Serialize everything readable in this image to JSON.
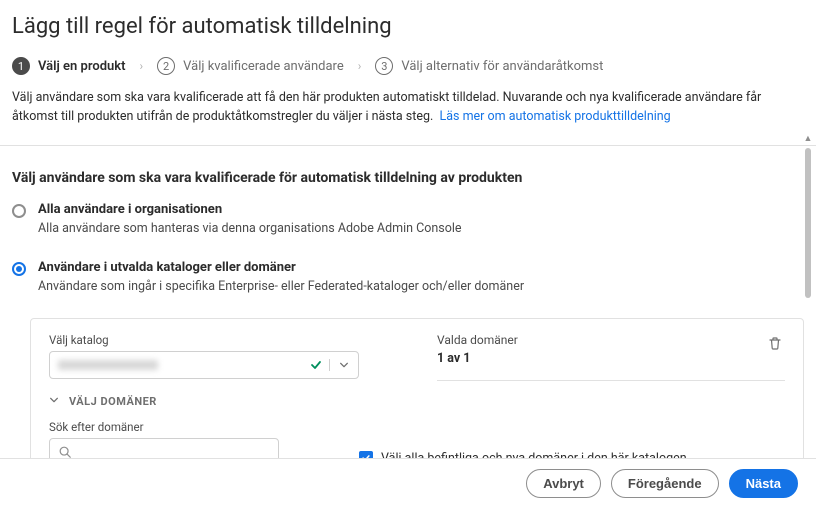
{
  "page": {
    "title": "Lägg till regel för automatisk tilldelning"
  },
  "stepper": {
    "steps": [
      {
        "num": "1",
        "label": "Välj en produkt",
        "active": true
      },
      {
        "num": "2",
        "label": "Välj kvalificerade användare",
        "active": false
      },
      {
        "num": "3",
        "label": "Välj alternativ för användaråtkomst",
        "active": false
      }
    ]
  },
  "intro": {
    "text": "Välj användare som ska vara kvalificerade att få den här produkten automatiskt tilldelad. Nuvarande och nya kvalificerade användare får åtkomst till produkten utifrån de produktåtkomstregler du väljer i nästa steg.",
    "link": "Läs mer om automatisk produkttilldelning"
  },
  "section": {
    "title": "Välj användare som ska vara kvalificerade för automatisk tilldelning av produkten"
  },
  "options": {
    "all": {
      "label": "Alla användare i organisationen",
      "desc": "Alla användare som hanteras via denna organisations Adobe Admin Console"
    },
    "selected": {
      "label": "Användare i utvalda kataloger eller domäner",
      "desc": "Användare som ingår i specifika Enterprise- eller Federated-kataloger och/eller domäner"
    }
  },
  "catalog": {
    "field_label": "Välj katalog",
    "domains_label": "Valda domäner",
    "domains_count": "1 av 1",
    "accordion_label": "VÄLJ DOMÄNER",
    "search_label": "Sök efter domäner",
    "search_placeholder": "",
    "checkbox_label": "Välj alla befintliga och nya domäner i den här katalogen"
  },
  "footer": {
    "cancel": "Avbryt",
    "prev": "Föregående",
    "next": "Nästa"
  }
}
